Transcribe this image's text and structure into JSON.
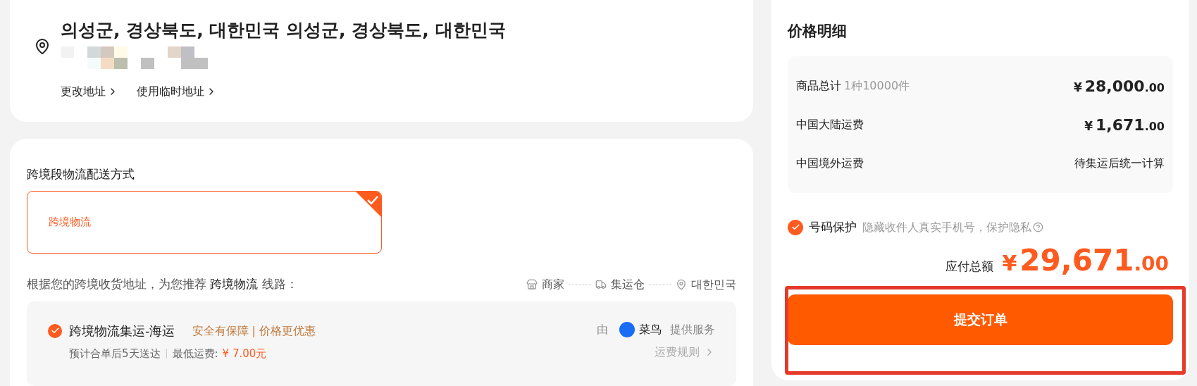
{
  "address": {
    "title": "의성군, 경상북도, 대한민국 의성군, 경상북도, 대한민국",
    "links": [
      "更改地址",
      "使用临时地址"
    ]
  },
  "shipping": {
    "heading": "跨境段物流配送方式",
    "options": [
      {
        "label": "跨境物流",
        "selected": true
      }
    ],
    "recommend": "根据您的跨境收货地址，为您推荐 **跨境物流** 线路：",
    "route": [
      {
        "kind": "store",
        "label": "商家"
      },
      {
        "kind": "truck",
        "label": "集运仓"
      },
      {
        "kind": "pin",
        "label": "대한민국"
      }
    ],
    "routes": [
      {
        "title": "跨境物流集运-海运",
        "tag": "安全有保障 | 价格更优惠",
        "selected": true,
        "by": "由",
        "provider": "菜鸟",
        "service": "提供服务",
        "eta": "预计合单后5天送达",
        "min_label": "最低运费: ",
        "min_price": "¥ 7.00元",
        "rules": "运费规则"
      }
    ]
  },
  "price": {
    "title": "价格明细",
    "rows": [
      {
        "label": "商品总计",
        "note": "1种10000件",
        "kind": "amount",
        "currency": "¥",
        "int": "28,000",
        "dec": ".00"
      },
      {
        "label": "中国大陆运费",
        "kind": "amount",
        "currency": "¥",
        "int": "1,671",
        "dec": ".00"
      },
      {
        "label": "中国境外运费",
        "kind": "text",
        "value": "待集运后统一计算"
      }
    ],
    "protect": {
      "checked": true,
      "label": "号码保护",
      "hint": "隐藏收件人真实手机号，保护隐私"
    },
    "total": {
      "label": "应付总额",
      "currency": "¥",
      "int": "29,671",
      "dec": ".00"
    },
    "submit": "提交订单",
    "highlighted": true
  }
}
